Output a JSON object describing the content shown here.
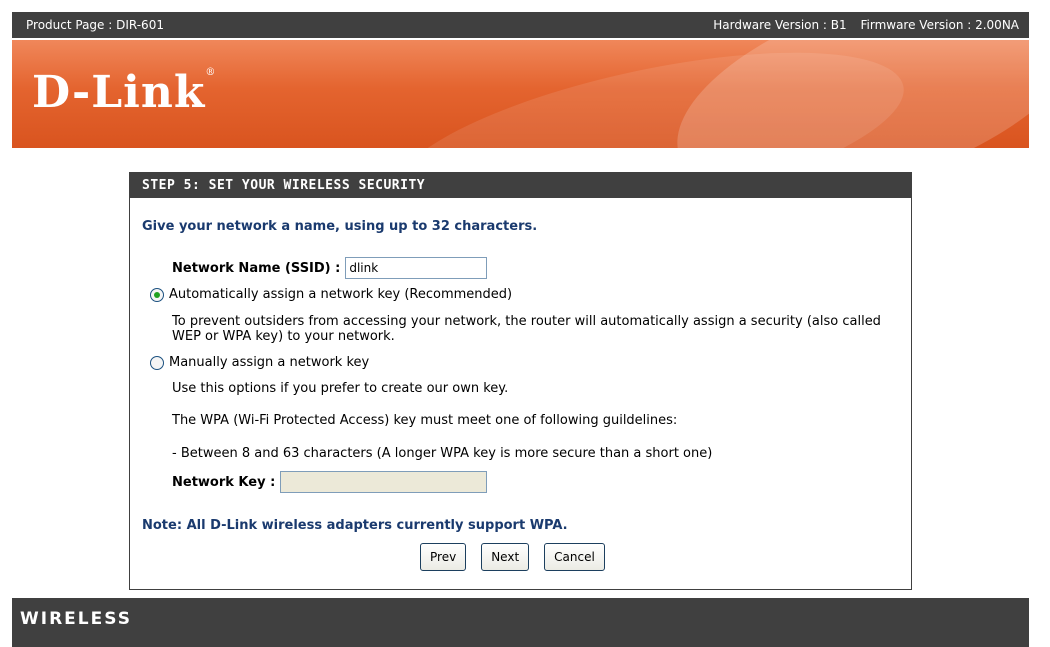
{
  "topbar": {
    "product": "Product Page : DIR-601",
    "hardware": "Hardware Version : B1",
    "firmware": "Firmware Version : 2.00NA"
  },
  "banner": {
    "logo": "D-Link",
    "logo_mark": "®"
  },
  "panel": {
    "title": "STEP 5: SET YOUR WIRELESS SECURITY",
    "intro": "Give your network a name, using up to 32 characters.",
    "ssid_label": "Network Name (SSID) :",
    "ssid_value": "dlink",
    "radio_auto_label": "Automatically assign a network key (Recommended)",
    "radio_auto_selected": true,
    "auto_desc": "To prevent outsiders from accessing your network, the router will automatically assign a security (also called WEP or WPA key) to your network.",
    "radio_manual_label": "Manually assign a network key",
    "radio_manual_selected": false,
    "manual_desc_1": "Use this options if you prefer to create our own key.",
    "manual_desc_2": "The WPA (Wi-Fi Protected Access) key must meet one of following guildelines:",
    "manual_desc_3": "- Between 8 and 63 characters (A longer WPA key is more secure than a short one)",
    "key_label": "Network Key :",
    "key_value": "",
    "note": "Note: All D-Link wireless adapters currently support WPA.",
    "buttons": {
      "prev": "Prev",
      "next": "Next",
      "cancel": "Cancel"
    }
  },
  "footer": {
    "label": "WIRELESS"
  }
}
